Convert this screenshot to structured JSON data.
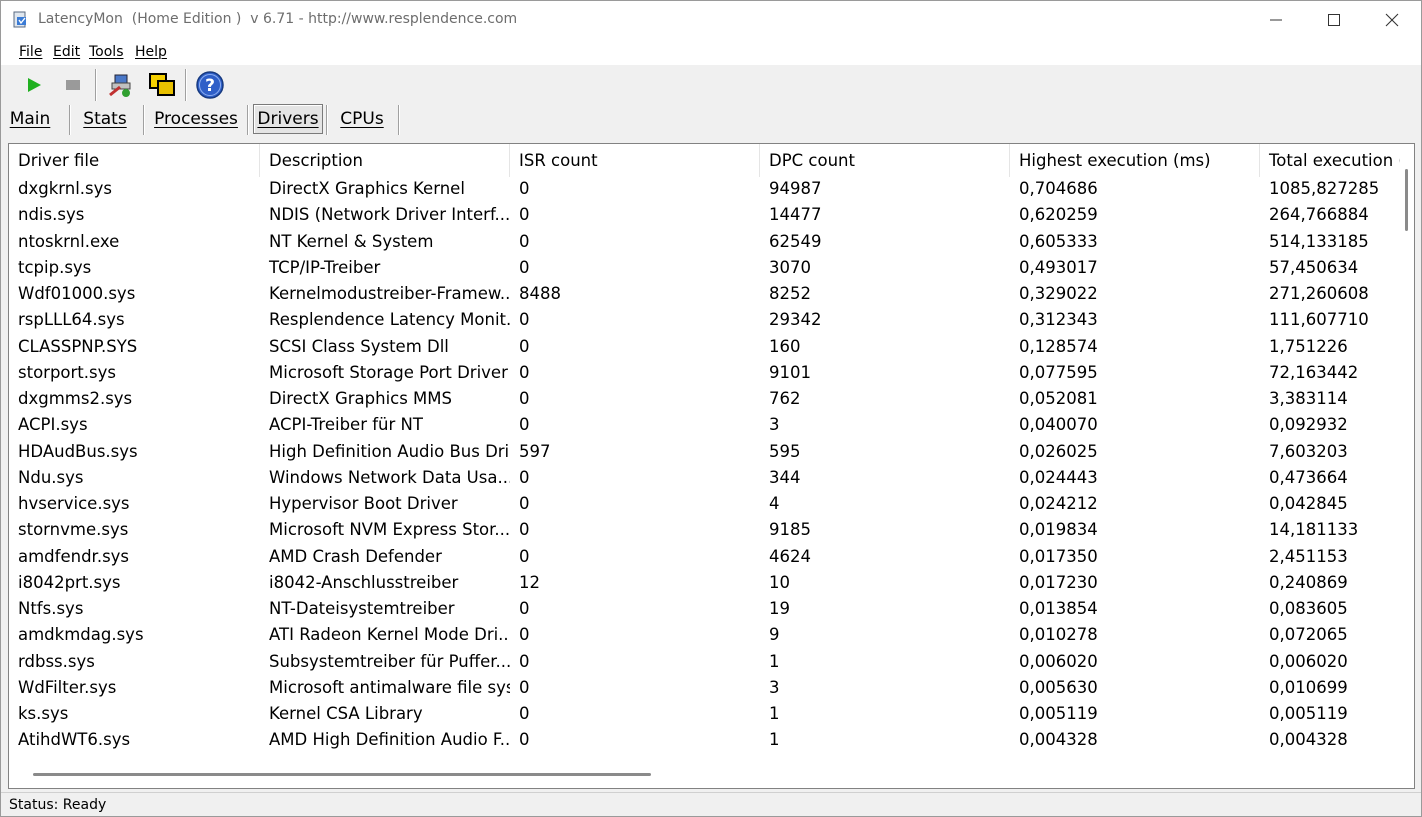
{
  "window": {
    "title": "LatencyMon  (Home Edition )  v 6.71 - http://www.resplendence.com"
  },
  "menu": [
    "File",
    "Edit",
    "Tools",
    "Help"
  ],
  "toolbar": {
    "buttons": [
      "play-icon",
      "stop-icon",
      "driver-analysis-icon",
      "windows-icon",
      "help-icon"
    ]
  },
  "tabs": [
    "Main",
    "Stats",
    "Processes",
    "Drivers",
    "CPUs"
  ],
  "active_tab": "Drivers",
  "table": {
    "columns": [
      "Driver file",
      "Description",
      "ISR count",
      "DPC count",
      "Highest execution (ms)",
      "Total execution ("
    ],
    "rows": [
      [
        "dxgkrnl.sys",
        "DirectX Graphics Kernel",
        "0",
        "94987",
        "0,704686",
        "1085,827285"
      ],
      [
        "ndis.sys",
        "NDIS (Network Driver Interf...",
        "0",
        "14477",
        "0,620259",
        "264,766884"
      ],
      [
        "ntoskrnl.exe",
        "NT Kernel & System",
        "0",
        "62549",
        "0,605333",
        "514,133185"
      ],
      [
        "tcpip.sys",
        "TCP/IP-Treiber",
        "0",
        "3070",
        "0,493017",
        "57,450634"
      ],
      [
        "Wdf01000.sys",
        "Kernelmodustreiber-Framew...",
        "8488",
        "8252",
        "0,329022",
        "271,260608"
      ],
      [
        "rspLLL64.sys",
        "Resplendence Latency Monit...",
        "0",
        "29342",
        "0,312343",
        "111,607710"
      ],
      [
        "CLASSPNP.SYS",
        "SCSI Class System Dll",
        "0",
        "160",
        "0,128574",
        "1,751226"
      ],
      [
        "storport.sys",
        "Microsoft Storage Port Driver",
        "0",
        "9101",
        "0,077595",
        "72,163442"
      ],
      [
        "dxgmms2.sys",
        "DirectX Graphics MMS",
        "0",
        "762",
        "0,052081",
        "3,383114"
      ],
      [
        "ACPI.sys",
        "ACPI-Treiber für NT",
        "0",
        "3",
        "0,040070",
        "0,092932"
      ],
      [
        "HDAudBus.sys",
        "High Definition Audio Bus Dri...",
        "597",
        "595",
        "0,026025",
        "7,603203"
      ],
      [
        "Ndu.sys",
        "Windows Network Data Usa...",
        "0",
        "344",
        "0,024443",
        "0,473664"
      ],
      [
        "hvservice.sys",
        "Hypervisor Boot Driver",
        "0",
        "4",
        "0,024212",
        "0,042845"
      ],
      [
        "stornvme.sys",
        "Microsoft NVM Express Stor...",
        "0",
        "9185",
        "0,019834",
        "14,181133"
      ],
      [
        "amdfendr.sys",
        "AMD Crash Defender",
        "0",
        "4624",
        "0,017350",
        "2,451153"
      ],
      [
        "i8042prt.sys",
        "i8042-Anschlusstreiber",
        "12",
        "10",
        "0,017230",
        "0,240869"
      ],
      [
        "Ntfs.sys",
        "NT-Dateisystemtreiber",
        "0",
        "19",
        "0,013854",
        "0,083605"
      ],
      [
        "amdkmdag.sys",
        "ATI Radeon Kernel Mode Dri...",
        "0",
        "9",
        "0,010278",
        "0,072065"
      ],
      [
        "rdbss.sys",
        "Subsystemtreiber für Puffer...",
        "0",
        "1",
        "0,006020",
        "0,006020"
      ],
      [
        "WdFilter.sys",
        "Microsoft antimalware file sys...",
        "0",
        "3",
        "0,005630",
        "0,010699"
      ],
      [
        "ks.sys",
        "Kernel CSA Library",
        "0",
        "1",
        "0,005119",
        "0,005119"
      ],
      [
        "AtihdWT6.sys",
        "AMD High Definition Audio F...",
        "0",
        "1",
        "0,004328",
        "0,004328"
      ]
    ]
  },
  "status": "Status: Ready"
}
